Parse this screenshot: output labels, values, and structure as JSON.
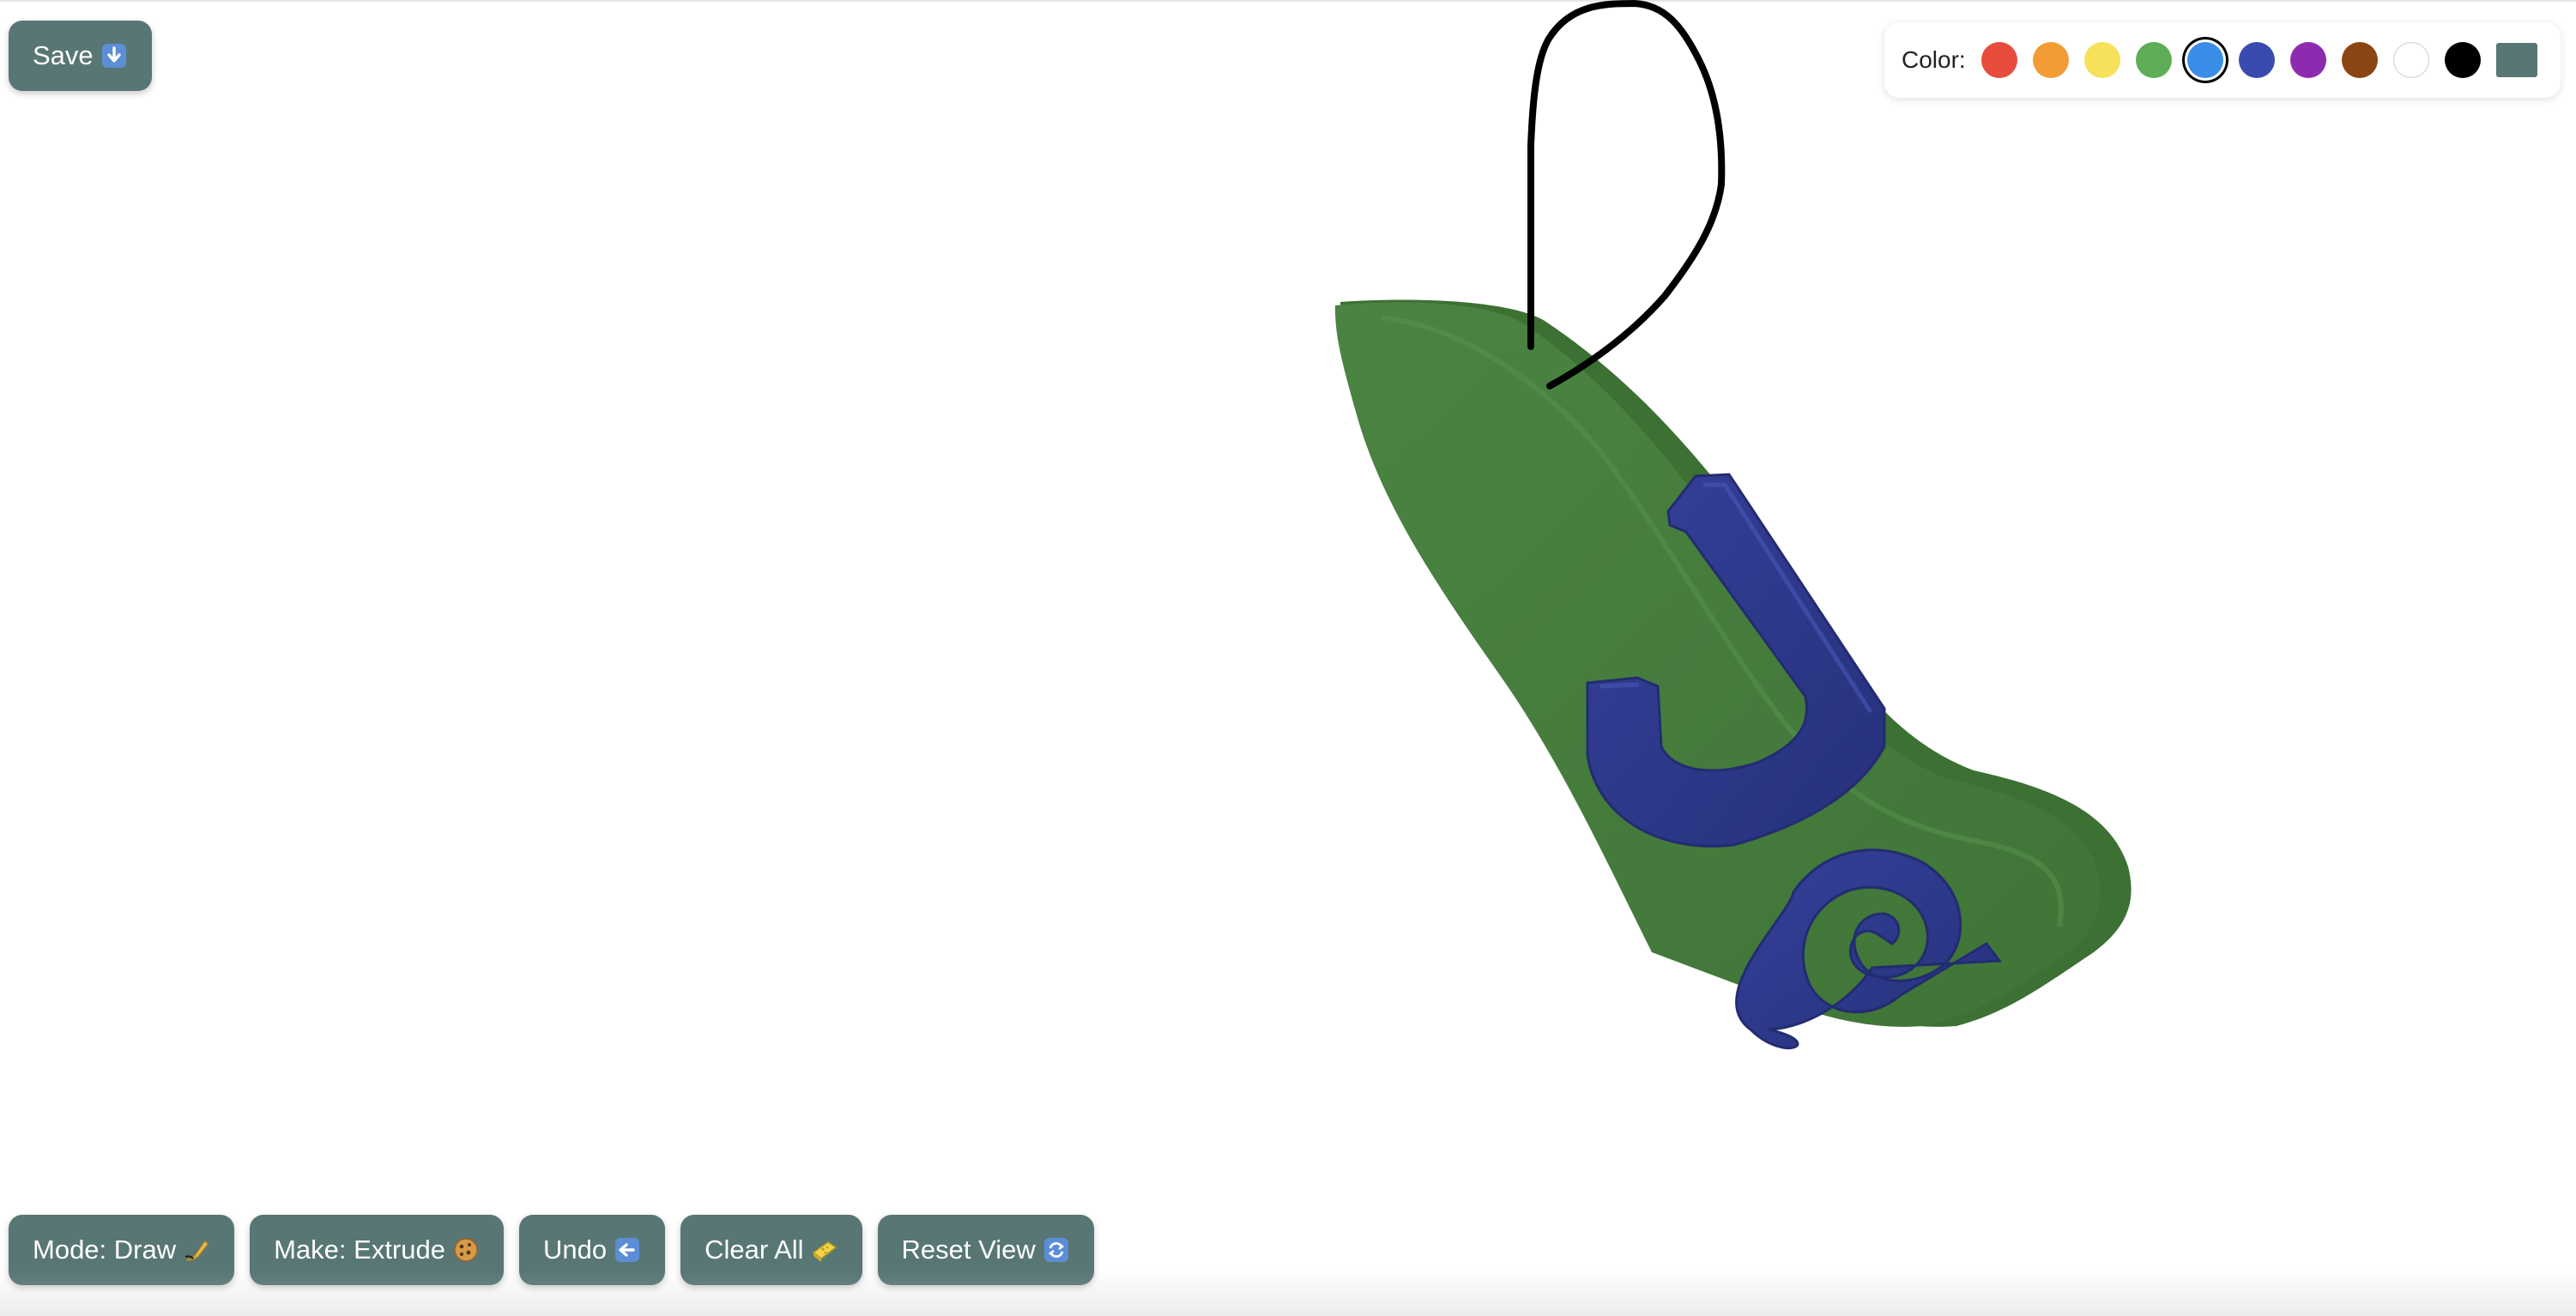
{
  "toolbar": {
    "save_label": "Save",
    "save_icon": "down-arrow-emoji",
    "buttons": [
      {
        "label": "Mode: Draw",
        "icon": "writing-hand-emoji"
      },
      {
        "label": "Make: Extrude",
        "icon": "cookie-emoji"
      },
      {
        "label": "Undo",
        "icon": "back-arrow-emoji"
      },
      {
        "label": "Clear All",
        "icon": "sponge-emoji"
      },
      {
        "label": "Reset View",
        "icon": "refresh-arrows-emoji"
      }
    ]
  },
  "palette": {
    "label": "Color:",
    "swatches": [
      {
        "name": "red",
        "color": "#e74c3c"
      },
      {
        "name": "orange",
        "color": "#f39c35"
      },
      {
        "name": "yellow",
        "color": "#f7e15a"
      },
      {
        "name": "green",
        "color": "#5fad57"
      },
      {
        "name": "blue",
        "color": "#3b8ee8",
        "selected": true
      },
      {
        "name": "indigo",
        "color": "#3a4bb0"
      },
      {
        "name": "purple",
        "color": "#8e2ab0"
      },
      {
        "name": "brown",
        "color": "#8b4513"
      },
      {
        "name": "white",
        "color": "#ffffff"
      },
      {
        "name": "black",
        "color": "#000000"
      }
    ],
    "custom_color": "#587674"
  },
  "scene": {
    "base_shape_color": "#467c3e",
    "extruded_letters_color": "#2d3a8f",
    "stroke_color": "#000000"
  }
}
